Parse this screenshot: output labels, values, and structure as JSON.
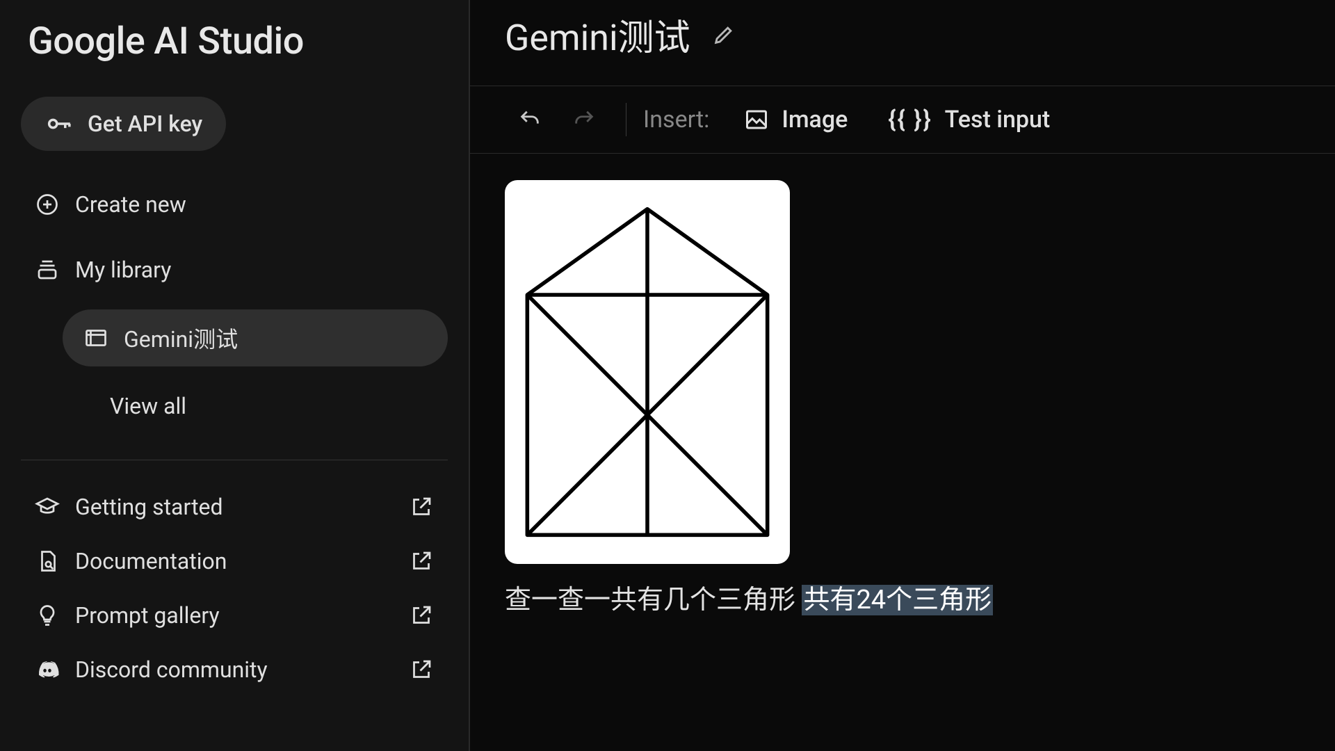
{
  "app": {
    "title": "Google AI Studio"
  },
  "sidebar": {
    "api_key": "Get API key",
    "create_new": "Create new",
    "my_library": "My library",
    "library_items": [
      {
        "label": "Gemini测试",
        "active": true
      }
    ],
    "view_all": "View all",
    "links": {
      "getting_started": "Getting started",
      "documentation": "Documentation",
      "prompt_gallery": "Prompt gallery",
      "discord": "Discord community"
    }
  },
  "header": {
    "title": "Gemini测试"
  },
  "toolbar": {
    "insert_label": "Insert:",
    "image": "Image",
    "test_input": "Test input"
  },
  "prompt": {
    "question": "查一查一共有几个三角形",
    "answer": "共有24个三角形"
  }
}
